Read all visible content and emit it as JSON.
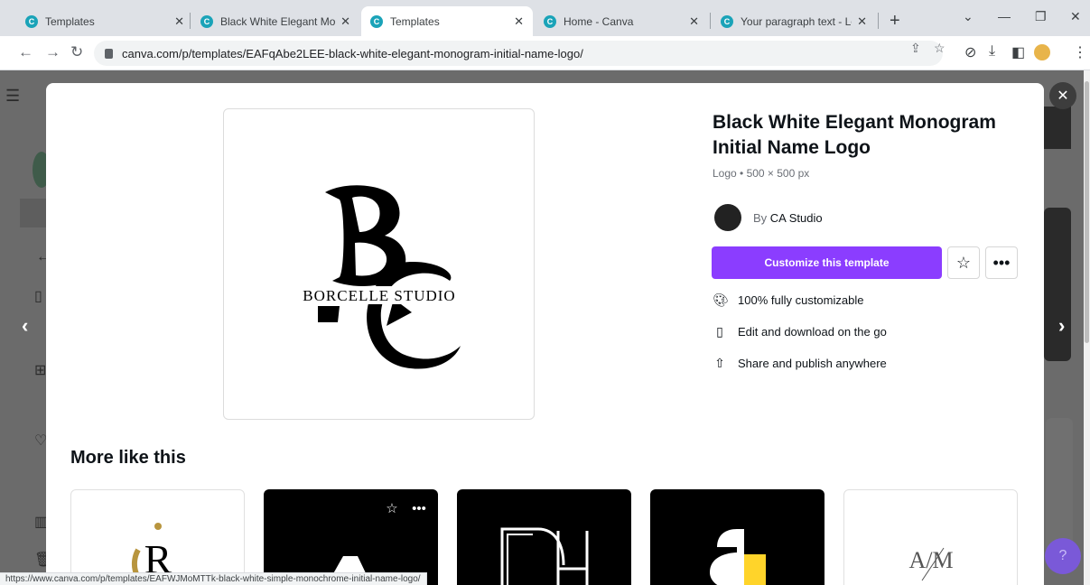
{
  "browser": {
    "tabs": [
      {
        "title": "Templates"
      },
      {
        "title": "Black White Elegant Monogr"
      },
      {
        "title": "Templates"
      },
      {
        "title": "Home - Canva"
      },
      {
        "title": "Your paragraph text - Logo"
      }
    ],
    "active_tab_index": 2,
    "url": "canva.com/p/templates/EAFqAbe2LEE-black-white-elegant-monogram-initial-name-logo/",
    "status_url": "https://www.canva.com/p/templates/EAFWJMoMTTk-black-white-simple-monochrome-initial-name-logo/"
  },
  "template": {
    "title": "Black White Elegant Monogram Initial Name Logo",
    "meta": "Logo • 500 × 500 px",
    "author_prefix": "By",
    "author": "CA Studio",
    "cta_label": "Customize this template",
    "features": [
      {
        "icon": "palette-icon",
        "label": "100% fully customizable"
      },
      {
        "icon": "phone-icon",
        "label": "Edit and download on the go"
      },
      {
        "icon": "share-icon",
        "label": "Share and publish anywhere"
      }
    ],
    "preview_text": "BORCELLE STUDIO"
  },
  "more": {
    "title": "More like this",
    "cards": [
      {
        "theme": "light"
      },
      {
        "theme": "dark"
      },
      {
        "theme": "dark"
      },
      {
        "theme": "dark"
      },
      {
        "theme": "light"
      }
    ],
    "last_card_text": "A/M"
  },
  "colors": {
    "accent": "#8b3dff",
    "overlay": "#6b6b6b",
    "gold": "#b8953e",
    "yellow": "#ffd42a"
  }
}
